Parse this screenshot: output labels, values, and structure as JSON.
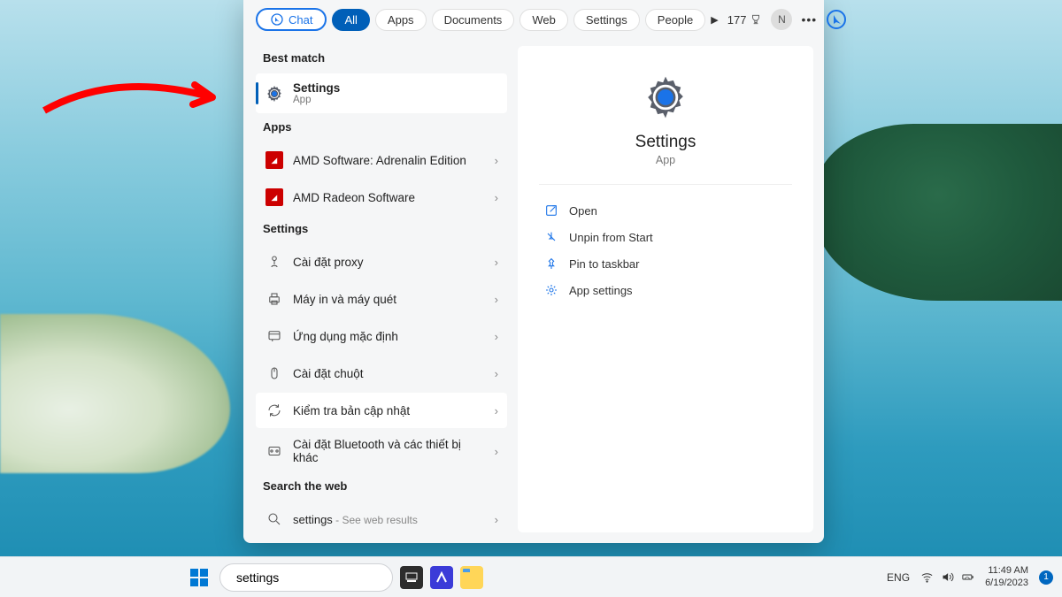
{
  "tabs": {
    "chat": "Chat",
    "items": [
      "All",
      "Apps",
      "Documents",
      "Web",
      "Settings",
      "People"
    ],
    "active_index": 0,
    "points": "177",
    "avatar_initial": "N"
  },
  "left": {
    "best_match_label": "Best match",
    "best_match": {
      "title": "Settings",
      "sub": "App"
    },
    "apps_label": "Apps",
    "apps": [
      {
        "title": "AMD Software: Adrenalin Edition",
        "icon": "amd"
      },
      {
        "title": "AMD Radeon Software",
        "icon": "amd"
      }
    ],
    "settings_label": "Settings",
    "settings": [
      {
        "title": "Cài đặt proxy",
        "icon": "proxy"
      },
      {
        "title": "Máy in và máy quét",
        "icon": "printer"
      },
      {
        "title": "Ứng dụng mặc định",
        "icon": "default-apps"
      },
      {
        "title": "Cài đặt chuột",
        "icon": "mouse"
      },
      {
        "title": "Kiểm tra bản cập nhật",
        "icon": "update",
        "hover": true
      },
      {
        "title": "Cài đặt Bluetooth và các thiết bị khác",
        "icon": "bluetooth"
      }
    ],
    "search_web_label": "Search the web",
    "search_web": {
      "term": "settings",
      "hint": " - See web results"
    }
  },
  "detail": {
    "title": "Settings",
    "sub": "App",
    "actions": [
      {
        "label": "Open",
        "icon": "open"
      },
      {
        "label": "Unpin from Start",
        "icon": "unpin"
      },
      {
        "label": "Pin to taskbar",
        "icon": "pin"
      },
      {
        "label": "App settings",
        "icon": "gear"
      }
    ]
  },
  "taskbar": {
    "search_value": "settings",
    "lang": "ENG",
    "time": "11:49 AM",
    "date": "6/19/2023",
    "notif_count": "1"
  }
}
